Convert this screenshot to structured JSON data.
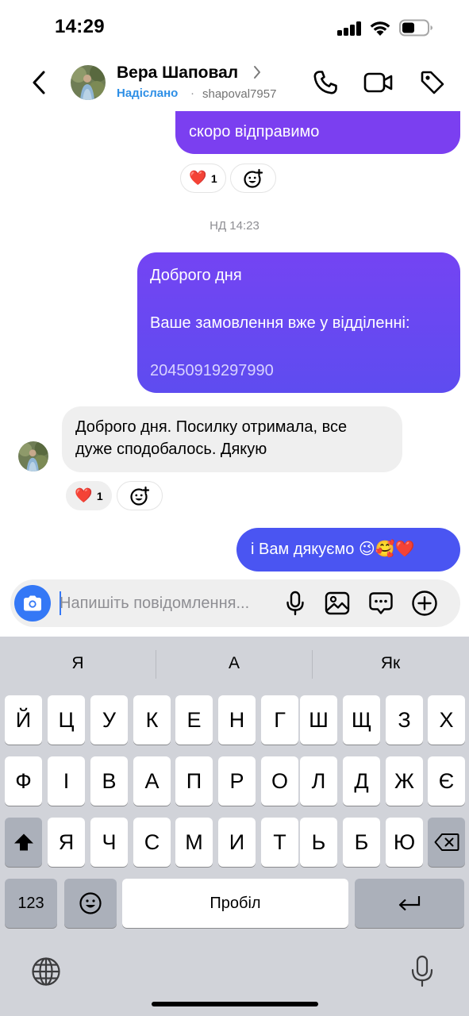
{
  "status_bar": {
    "time": "14:29"
  },
  "header": {
    "contact_name": "Вера Шаповал",
    "status": "Надіслано",
    "separator": "·",
    "username": "shapoval7957"
  },
  "chat": {
    "messages": [
      {
        "direction": "outgoing",
        "text": "скоро відправимо"
      },
      {
        "direction": "outgoing",
        "lines": [
          "Доброго дня",
          "",
          "Ваше замовлення вже у відділенні:",
          "",
          "20450919297990"
        ]
      },
      {
        "direction": "incoming",
        "lines": [
          "Доброго дня. Посилку отримала, все",
          "дуже сподобалось. Дякую"
        ]
      },
      {
        "direction": "outgoing",
        "text": "і Вам дякуємо 😉🥰❤️"
      }
    ],
    "reactions": [
      {
        "emoji": "❤️",
        "count": "1"
      },
      {
        "emoji": "❤️",
        "count": "1"
      }
    ],
    "date_separator": "НД 14:23"
  },
  "composer": {
    "placeholder": "Напишіть повідомлення..."
  },
  "keyboard": {
    "suggestions": [
      "Я",
      "А",
      "Як"
    ],
    "row1": [
      "Й",
      "Ц",
      "У",
      "К",
      "Е",
      "Н",
      "Г",
      "Ш",
      "Щ",
      "З",
      "Х"
    ],
    "row2": [
      "Ф",
      "І",
      "В",
      "А",
      "П",
      "Р",
      "О",
      "Л",
      "Д",
      "Ж",
      "Є"
    ],
    "row3": [
      "Я",
      "Ч",
      "С",
      "М",
      "И",
      "Т",
      "Ь",
      "Б",
      "Ю"
    ],
    "numbers_label": "123",
    "space_label": "Пробіл"
  },
  "colors": {
    "outgoing_purple": "#7b3ff0",
    "outgoing_blue": "#4a55f2",
    "accent_blue": "#3478f6",
    "status_blue": "#2e8fe6"
  }
}
